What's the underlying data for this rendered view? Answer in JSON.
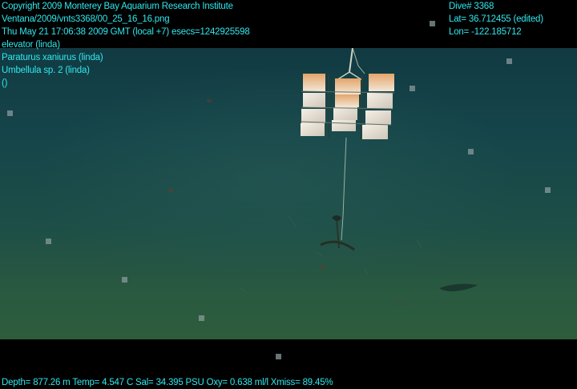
{
  "overlay_top_left": [
    "Copyright 2009 Monterey Bay Aquarium Research Institute",
    "Ventana/2009/vnts3368/00_25_16_16.png",
    "Thu May 21 17:06:38 2009 GMT (local +7)  esecs=1242925598",
    "elevator (linda)",
    "Paraturus xaniurus (linda)",
    "Umbellula sp. 2 (linda)",
    "()"
  ],
  "overlay_top_right": [
    "Dive# 3368",
    "Lat= 36.712455 (edited)",
    "Lon= -122.185712"
  ],
  "overlay_bottom": "Depth= 877.26 m  Temp= 4.547 C  Sal= 34.395 PSU  Oxy= 0.638 ml/l  Xmiss= 89.45%",
  "colors": {
    "overlay_text": "#2fe8ee",
    "water_top": "#113a42",
    "seafloor": "#2d5d3c",
    "frame_border": "#000000"
  }
}
